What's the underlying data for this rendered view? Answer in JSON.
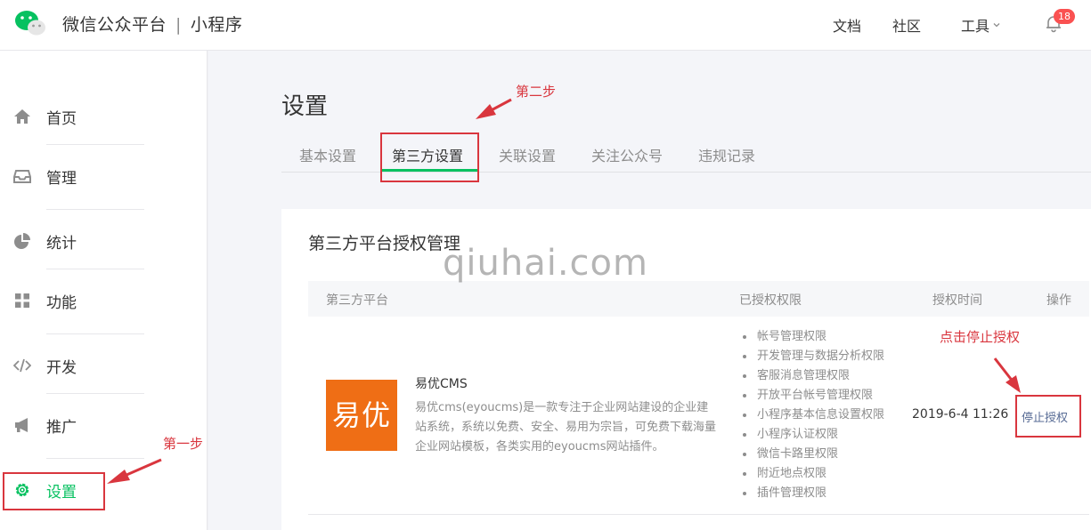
{
  "header": {
    "brand": "微信公众平台",
    "separator": "|",
    "product": "小程序",
    "links": [
      "文档",
      "社区",
      "工具"
    ],
    "notification_count": "18"
  },
  "sidebar": {
    "items": [
      {
        "label": "首页",
        "icon": "home-icon"
      },
      {
        "label": "管理",
        "icon": "inbox-icon"
      },
      {
        "label": "统计",
        "icon": "pie-chart-icon"
      },
      {
        "label": "功能",
        "icon": "grid-icon"
      },
      {
        "label": "开发",
        "icon": "code-icon"
      },
      {
        "label": "推广",
        "icon": "megaphone-icon"
      },
      {
        "label": "设置",
        "icon": "gear-icon",
        "active": true
      }
    ]
  },
  "page": {
    "title": "设置",
    "tabs": [
      "基本设置",
      "第三方设置",
      "关联设置",
      "关注公众号",
      "违规记录"
    ],
    "active_tab": "第三方设置"
  },
  "card": {
    "title": "第三方平台授权管理",
    "columns": [
      "第三方平台",
      "已授权权限",
      "授权时间",
      "操作"
    ],
    "row": {
      "logo_text": "易优",
      "name": "易优CMS",
      "description": "易优cms(eyoucms)是一款专注于企业网站建设的企业建站系统，系统以免费、安全、易用为宗旨，可免费下载海量企业网站模板，各类实用的eyoucms网站插件。",
      "permissions": [
        "帐号管理权限",
        "开发管理与数据分析权限",
        "客服消息管理权限",
        "开放平台帐号管理权限",
        "小程序基本信息设置权限",
        "小程序认证权限",
        "微信卡路里权限",
        "附近地点权限",
        "插件管理权限"
      ],
      "auth_time": "2019-6-4 11:26",
      "action": "停止授权"
    }
  },
  "annotations": {
    "step1": "第一步",
    "step2": "第二步",
    "step3": "点击停止授权",
    "watermark": "qiuhai.com",
    "color": "#d9363e"
  },
  "colors": {
    "accent_green": "#07c160",
    "link_blue": "#576b95",
    "logo_orange": "#ef6e15",
    "badge_red": "#fa5151"
  }
}
